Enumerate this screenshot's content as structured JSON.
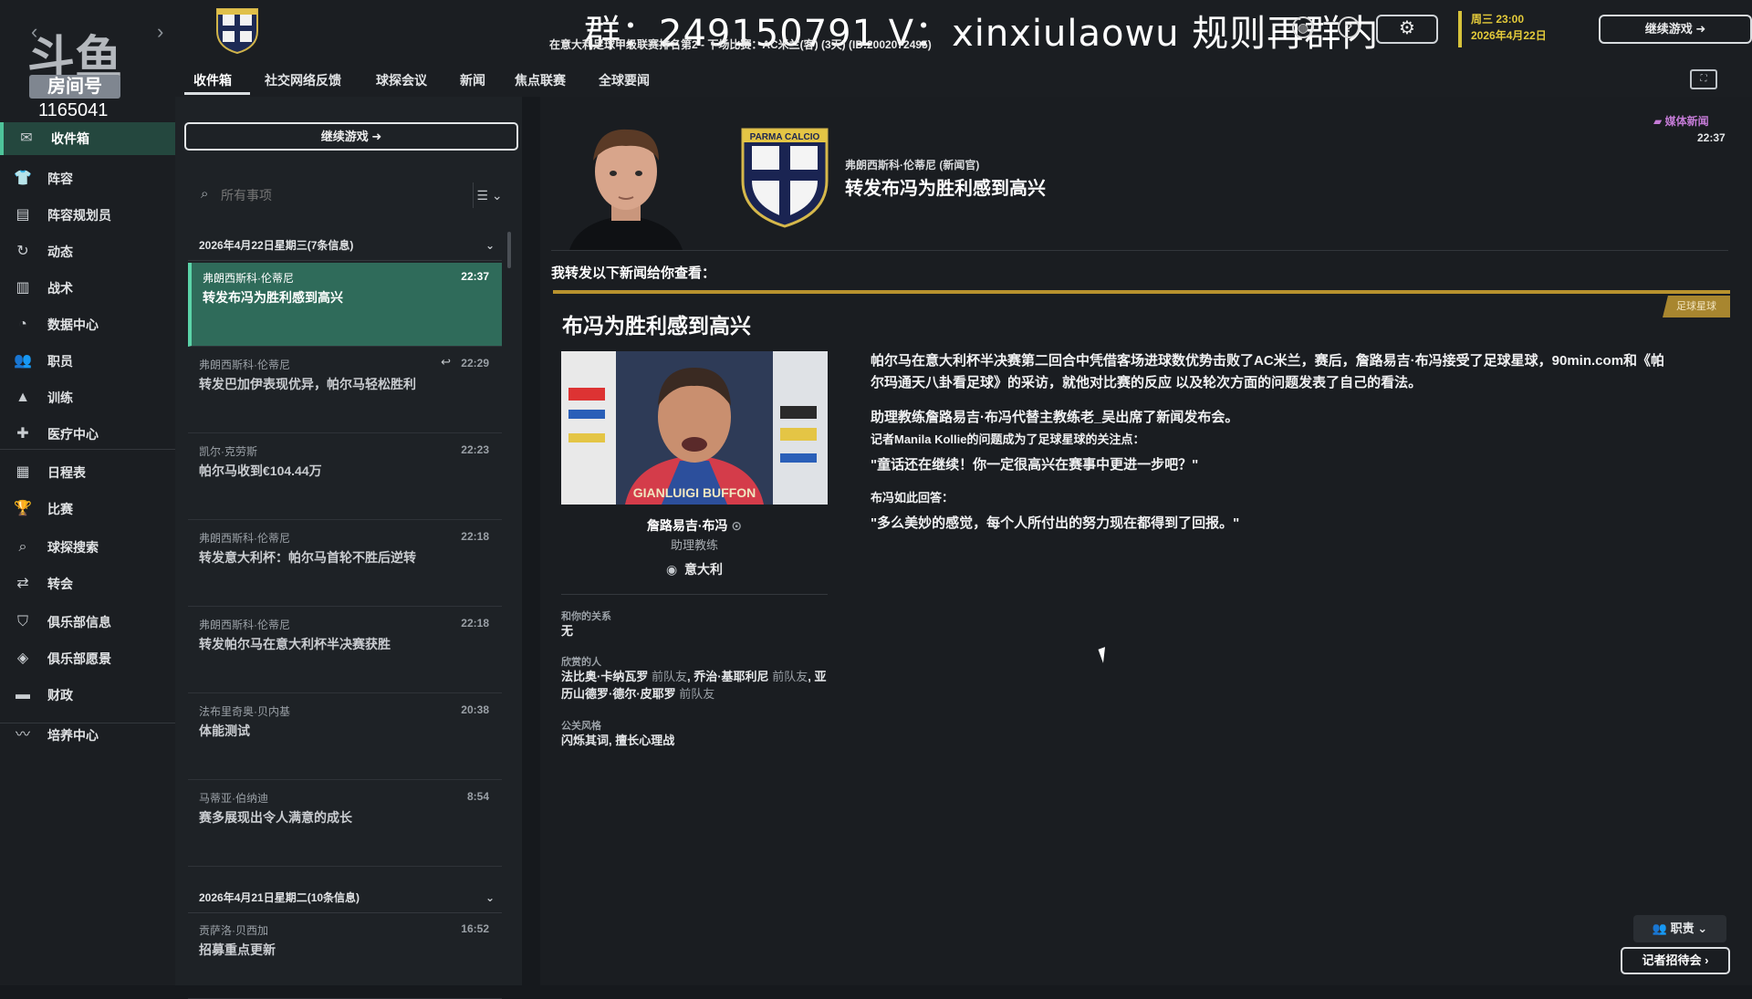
{
  "overlay": {
    "watermark": "群：249150791 V：xinxiulaowu 规则再群内",
    "logo_text": "斗鱼",
    "room_label": "房间号",
    "room_number": "1165041"
  },
  "topbar": {
    "title_overlay": "收件箱",
    "match_info": "在意大利足球甲级联赛排名第2 - 下场比赛：AC米兰(客) (3天) (ID:2002072495)",
    "day_time": "周三 23:00",
    "date": "2026年4月22日",
    "continue_label": "继续游戏"
  },
  "sidebar": {
    "items": [
      {
        "label": "收件箱",
        "icon": "inbox-icon"
      },
      {
        "label": "阵容",
        "icon": "shirt-icon"
      },
      {
        "label": "阵容规划员",
        "icon": "clipboard-icon"
      },
      {
        "label": "动态",
        "icon": "dynamics-icon"
      },
      {
        "label": "战术",
        "icon": "tactics-icon"
      },
      {
        "label": "数据中心",
        "icon": "data-icon"
      },
      {
        "label": "职员",
        "icon": "staff-icon"
      },
      {
        "label": "训练",
        "icon": "training-icon"
      },
      {
        "label": "医疗中心",
        "icon": "medical-icon"
      },
      {
        "label": "日程表",
        "icon": "calendar-icon"
      },
      {
        "label": "比赛",
        "icon": "trophy-icon"
      },
      {
        "label": "球探搜索",
        "icon": "search-icon"
      },
      {
        "label": "转会",
        "icon": "transfer-icon"
      },
      {
        "label": "俱乐部信息",
        "icon": "shield-icon"
      },
      {
        "label": "俱乐部愿景",
        "icon": "vision-icon"
      },
      {
        "label": "财政",
        "icon": "finance-icon"
      },
      {
        "label": "培养中心",
        "icon": "development-icon"
      }
    ]
  },
  "tabs": [
    "收件箱",
    "社交网络反馈",
    "球探会议",
    "新闻",
    "焦点联赛",
    "全球要闻"
  ],
  "inbox": {
    "continue_label": "继续游戏",
    "search_placeholder": "所有事项",
    "groups": [
      {
        "header": "2026年4月22日星期三(7条信息)",
        "messages": [
          {
            "sender": "弗朗西斯科·伦蒂尼",
            "time": "22:37",
            "subject": "转发布冯为胜利感到高兴",
            "selected": true
          },
          {
            "sender": "弗朗西斯科·伦蒂尼",
            "time": "22:29",
            "subject": "转发巴加伊表现优异，帕尔马轻松胜利",
            "replied": true
          },
          {
            "sender": "凯尔·克劳斯",
            "time": "22:23",
            "subject": "帕尔马收到€104.44万"
          },
          {
            "sender": "弗朗西斯科·伦蒂尼",
            "time": "22:18",
            "subject": "转发意大利杯：帕尔马首轮不胜后逆转"
          },
          {
            "sender": "弗朗西斯科·伦蒂尼",
            "time": "22:18",
            "subject": "转发帕尔马在意大利杯半决赛获胜"
          },
          {
            "sender": "法布里奇奥·贝内基",
            "time": "20:38",
            "subject": "体能测试"
          },
          {
            "sender": "马蒂亚·伯纳迪",
            "time": "8:54",
            "subject": "赛多展现出令人满意的成长"
          }
        ]
      },
      {
        "header": "2026年4月21日星期二(10条信息)",
        "messages": [
          {
            "sender": "贡萨洛·贝西加",
            "time": "16:52",
            "subject": "招募重点更新"
          }
        ]
      }
    ]
  },
  "message": {
    "media_tag": "媒体新闻",
    "time": "22:37",
    "sender": "弗朗西斯科·伦蒂尼 (新闻官)",
    "title": "转发布冯为胜利感到高兴",
    "forward_note": "我转发以下新闻给你查看：",
    "badge": "足球星球",
    "article_title": "布冯为胜利感到高兴",
    "photo_caption": "GIANLUIGI BUFFON",
    "person": {
      "name": "詹路易吉·布冯",
      "role": "助理教练",
      "nationality": "意大利"
    },
    "relationship_label": "和你的关系",
    "relationship_value": "无",
    "admired_label": "欣赏的人",
    "admired": [
      {
        "name": "法比奥·卡纳瓦罗",
        "note": "前队友",
        "sep": ", "
      },
      {
        "name": "乔治·基耶利尼",
        "note": "前队友",
        "sep": ", "
      },
      {
        "name": "亚历山德罗·德尔·皮耶罗",
        "note": "前队友",
        "sep": ""
      }
    ],
    "pr_label": "公关风格",
    "pr_value": "闪烁其词, 擅长心理战",
    "body": [
      "帕尔马在意大利杯半决赛第二回合中凭借客场进球数优势击败了AC米兰，赛后，詹路易吉·布冯接受了足球星球，90min.com和《帕尔玛通天八卦看足球》的采访，就他对比赛的反应 以及轮次方面的问题发表了自己的看法。",
      "助理教练詹路易吉·布冯代替主教练老_吴出席了新闻发布会。",
      "记者Manila Kollie的问题成为了足球星球的关注点：",
      "\"童话还在继续！你一定很高兴在赛事中更进一步吧？\"",
      "布冯如此回答：",
      "\"多么美妙的感觉，每个人所付出的努力现在都得到了回报。\""
    ],
    "role_button": "职责",
    "press_button": "记者招待会"
  },
  "colors": {
    "accent_green": "#2f6b5a",
    "gold": "#b8922e",
    "date_yellow": "#e4cb3a",
    "media_purple": "#c47bd6"
  }
}
